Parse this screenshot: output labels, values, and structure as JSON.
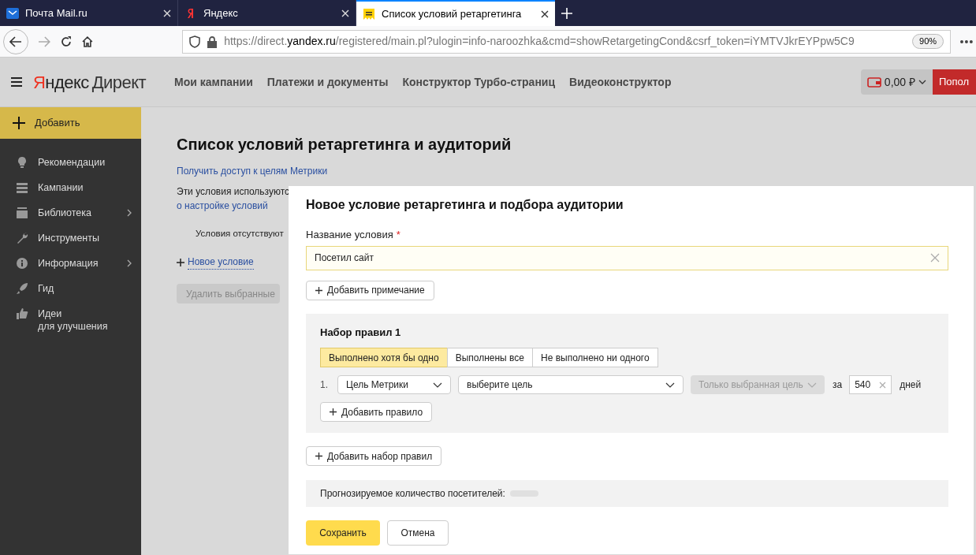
{
  "browser_tabs": [
    {
      "title": "Почта Mail.ru",
      "selected": false
    },
    {
      "title": "Яндекс",
      "selected": false
    },
    {
      "title": "Список условий ретаргетинга",
      "selected": true
    }
  ],
  "address_bar": {
    "url_pre": "https://direct.",
    "url_host": "yandex.ru",
    "url_post": "/registered/main.pl?ulogin=info-naroozhka&cmd=showRetargetingCond&csrf_token=iYMTVJkrEYPpw5C9",
    "zoom": "90%"
  },
  "header": {
    "logo_red": "Я",
    "logo_black": "ндекс",
    "logo_product": "Директ",
    "nav": [
      "Мои кампании",
      "Платежи и документы",
      "Конструктор Турбо-страниц",
      "Видеоконструктор"
    ],
    "balance": "0,00 ₽",
    "topup": "Попол"
  },
  "sidebar": {
    "add": "Добавить",
    "items": [
      {
        "label": "Рекомендации",
        "has_submenu": false
      },
      {
        "label": "Кампании",
        "has_submenu": false
      },
      {
        "label": "Библиотека",
        "has_submenu": true
      },
      {
        "label": "Инструменты",
        "has_submenu": false
      },
      {
        "label": "Информация",
        "has_submenu": true
      },
      {
        "label": "Гид",
        "has_submenu": false
      },
      {
        "label": "Идеи\nдля улучшения",
        "has_submenu": false
      }
    ]
  },
  "page": {
    "title": "Список условий ретаргетинга и аудиторий",
    "metrika_link": "Получить доступ к целям Метрики",
    "description": "Эти условия используютс",
    "settings_link": "о настройке условий",
    "empty": "Условия отсутствуют",
    "new_condition": "Новое условие",
    "delete_selected": "Удалить выбранные"
  },
  "dialog": {
    "title": "Новое условие ретаргетинга и подбора аудитории",
    "name_label": "Название условия",
    "required_mark": "*",
    "name_value": "Посетил сайт",
    "add_note": "Добавить примечание",
    "rule_sets": [
      {
        "title": "Набор правил 1",
        "modes": [
          {
            "label": "Выполнено хотя бы одно",
            "selected": true
          },
          {
            "label": "Выполнены все",
            "selected": false
          },
          {
            "label": "Не выполнено ни одного",
            "selected": false
          }
        ],
        "rules": [
          {
            "number": "1.",
            "type": "Цель Метрики",
            "goal": "выберите цель",
            "scope": "Только выбранная цель",
            "scope_disabled": true,
            "period_prefix": "за",
            "days": "540",
            "period_suffix": "дней"
          }
        ],
        "add_rule": "Добавить правило"
      }
    ],
    "add_rule_set": "Добавить набор правил",
    "forecast_label": "Прогнозируемое количество посетителей:",
    "save": "Сохранить",
    "cancel": "Отмена"
  }
}
